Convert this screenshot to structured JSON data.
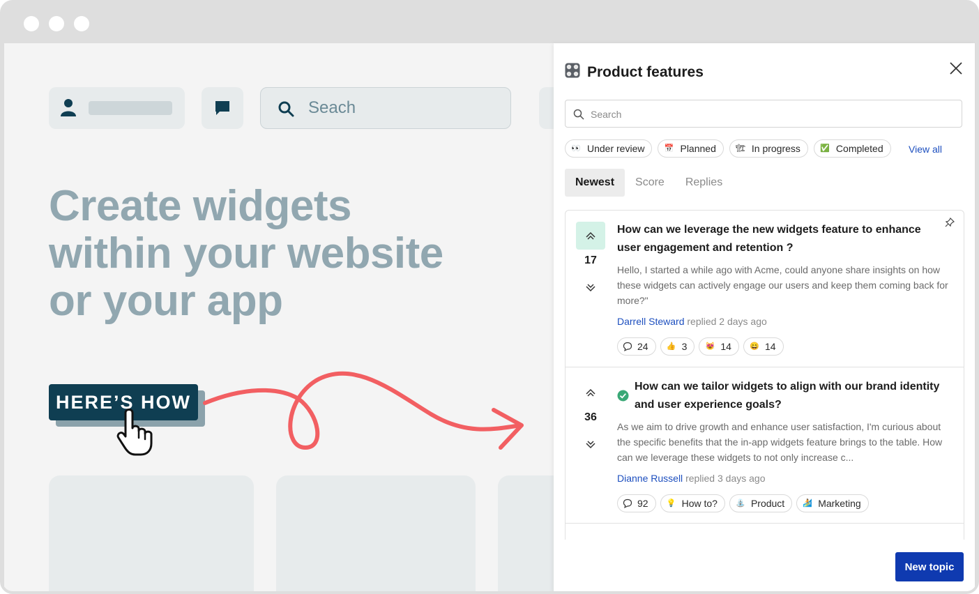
{
  "background_page": {
    "search_placeholder": "Seach",
    "headline": "Create widgets within your website or your app",
    "cta_label": "HERE’S HOW"
  },
  "panel": {
    "title": "Product features",
    "title_icon": "control-knobs-icon",
    "search_placeholder": "Search",
    "statuses": [
      {
        "label": "Under review",
        "icon": "👀"
      },
      {
        "label": "Planned",
        "icon": "📅"
      },
      {
        "label": "In progress",
        "icon": "🏗"
      },
      {
        "label": "Completed",
        "icon": "✅"
      }
    ],
    "view_all": "View all",
    "tabs": [
      {
        "label": "Newest",
        "active": true
      },
      {
        "label": "Score",
        "active": false
      },
      {
        "label": "Replies",
        "active": false
      }
    ],
    "topics": [
      {
        "votes": "17",
        "upvoted": true,
        "pinned": true,
        "completed": false,
        "title": "How can we leverage the new widgets feature to enhance user engagement and retention ?",
        "body": "Hello, I started a while ago with Acme, could anyone share insights on how these widgets can actively engage our users and keep them coming back for more?\"",
        "author": "Darrell Steward",
        "replied": "replied 2 days ago",
        "chips": [
          {
            "icon": "💬",
            "label": "24"
          },
          {
            "icon": "👍",
            "label": "3"
          },
          {
            "icon": "😻",
            "label": "14"
          },
          {
            "icon": "😄",
            "label": "14"
          }
        ]
      },
      {
        "votes": "36",
        "upvoted": false,
        "pinned": false,
        "completed": true,
        "title": "How can we tailor widgets to align with our brand identity and user experience goals?",
        "body": "As we aim to drive growth and enhance user satisfaction, I'm curious about the specific benefits that the in-app widgets feature brings to the table. How can we leverage these widgets to not only increase c...",
        "author": "Dianne Russell",
        "replied": "replied 3 days ago",
        "chips": [
          {
            "icon": "💬",
            "label": "92"
          },
          {
            "icon": "💡",
            "label": "How to?"
          },
          {
            "icon": "⛲",
            "label": "Product"
          },
          {
            "icon": "🏄",
            "label": "Marketing"
          }
        ]
      }
    ],
    "new_topic_label": "New topic"
  },
  "colors": {
    "accent": "#0f3ab0",
    "cta": "#0f3e52",
    "arrow": "#f25f62",
    "upvote_bg": "#d4f2e7",
    "completed": "#3aa876"
  }
}
